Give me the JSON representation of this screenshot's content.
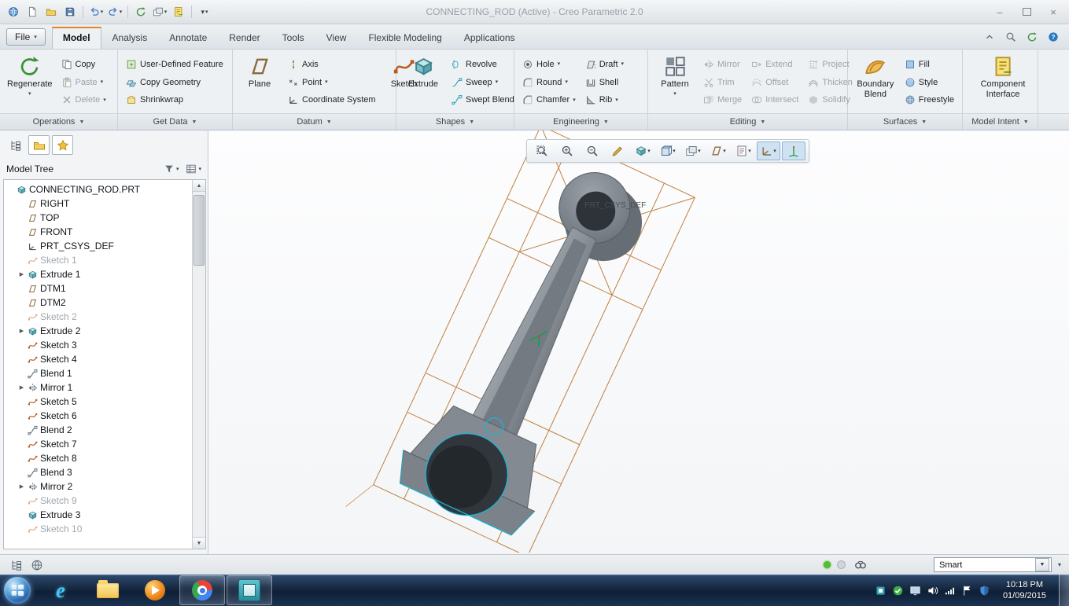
{
  "window": {
    "title": "CONNECTING_ROD (Active) - Creo Parametric 2.0"
  },
  "quick_access": {
    "items": [
      {
        "n": "app"
      },
      {
        "n": "new-document"
      },
      {
        "n": "open-file"
      },
      {
        "n": "save"
      },
      {
        "sep": true
      },
      {
        "n": "undo",
        "drop": true
      },
      {
        "n": "redo",
        "drop": true
      },
      {
        "sep": true
      },
      {
        "n": "regenerate-quick"
      },
      {
        "n": "window-arrange",
        "drop": true
      },
      {
        "n": "window-new"
      },
      {
        "sep": true
      },
      {
        "n": "customize-menu",
        "drop": true
      }
    ]
  },
  "ribbon": {
    "file": "File",
    "tabs": [
      "Model",
      "Analysis",
      "Annotate",
      "Render",
      "Tools",
      "View",
      "Flexible Modeling",
      "Applications"
    ],
    "active_tab": "Model",
    "groups": [
      "Operations",
      "Get Data",
      "Datum",
      "Shapes",
      "Engineering",
      "Editing",
      "Surfaces",
      "Model Intent"
    ],
    "buttons": {
      "regenerate": "Regenerate",
      "copy": "Copy",
      "paste": "Paste",
      "delete": "Delete",
      "udf": "User-Defined Feature",
      "copy_geometry": "Copy Geometry",
      "shrinkwrap": "Shrinkwrap",
      "plane": "Plane",
      "axis": "Axis",
      "point": "Point",
      "coordinate_system": "Coordinate System",
      "sketch": "Sketch",
      "extrude": "Extrude",
      "revolve": "Revolve",
      "sweep": "Sweep",
      "swept_blend": "Swept Blend",
      "hole": "Hole",
      "round": "Round",
      "chamfer": "Chamfer",
      "draft": "Draft",
      "shell": "Shell",
      "rib": "Rib",
      "pattern": "Pattern",
      "mirror": "Mirror",
      "trim": "Trim",
      "merge": "Merge",
      "extend": "Extend",
      "offset": "Offset",
      "intersect": "Intersect",
      "project": "Project",
      "thicken": "Thicken",
      "solidify": "Solidify",
      "boundary_blend": "Boundary Blend",
      "fill": "Fill",
      "style": "Style",
      "freestyle": "Freestyle",
      "component_interface": "Component Interface"
    },
    "right_icons": [
      {
        "n": "collapse-ribbon"
      },
      {
        "n": "search-commands"
      },
      {
        "n": "sync"
      },
      {
        "n": "help"
      }
    ]
  },
  "panel": {
    "toolbar": [
      {
        "n": "nav-tree"
      },
      {
        "n": "folder-browser",
        "pressed": true
      },
      {
        "n": "favorites",
        "pressed": true
      }
    ],
    "header": {
      "title": "Model Tree",
      "icons": [
        {
          "n": "tree-filters",
          "drop": true
        },
        {
          "n": "tree-columns",
          "drop": true
        }
      ]
    },
    "tree": {
      "items": [
        {
          "label": "CONNECTING_ROD.PRT",
          "type": "part",
          "level": 0
        },
        {
          "label": "RIGHT",
          "type": "plane",
          "level": 1
        },
        {
          "label": "TOP",
          "type": "plane",
          "level": 1
        },
        {
          "label": "FRONT",
          "type": "plane",
          "level": 1
        },
        {
          "label": "PRT_CSYS_DEF",
          "type": "csys",
          "level": 1
        },
        {
          "label": "Sketch 1",
          "type": "sketch",
          "level": 1,
          "dim": true
        },
        {
          "label": "Extrude 1",
          "type": "extrude",
          "level": 1,
          "expand": true
        },
        {
          "label": "DTM1",
          "type": "plane",
          "level": 1
        },
        {
          "label": "DTM2",
          "type": "plane",
          "level": 1
        },
        {
          "label": "Sketch 2",
          "type": "sketch",
          "level": 1,
          "dim": true
        },
        {
          "label": "Extrude 2",
          "type": "extrude",
          "level": 1,
          "expand": true
        },
        {
          "label": "Sketch 3",
          "type": "sketch",
          "level": 1
        },
        {
          "label": "Sketch 4",
          "type": "sketch",
          "level": 1
        },
        {
          "label": "Blend 1",
          "type": "blend",
          "level": 1
        },
        {
          "label": "Mirror 1",
          "type": "mirror",
          "level": 1,
          "expand": true
        },
        {
          "label": "Sketch 5",
          "type": "sketch",
          "level": 1
        },
        {
          "label": "Sketch 6",
          "type": "sketch",
          "level": 1
        },
        {
          "label": "Blend 2",
          "type": "blend",
          "level": 1
        },
        {
          "label": "Sketch 7",
          "type": "sketch",
          "level": 1
        },
        {
          "label": "Sketch 8",
          "type": "sketch",
          "level": 1
        },
        {
          "label": "Blend 3",
          "type": "blend",
          "level": 1
        },
        {
          "label": "Mirror 2",
          "type": "mirror",
          "level": 1,
          "expand": true
        },
        {
          "label": "Sketch 9",
          "type": "sketch",
          "level": 1,
          "dim": true
        },
        {
          "label": "Extrude 3",
          "type": "extrude",
          "level": 1
        },
        {
          "label": "Sketch 10",
          "type": "sketch",
          "level": 1,
          "dim": true
        }
      ]
    }
  },
  "canvas": {
    "toolbar": [
      {
        "n": "refit"
      },
      {
        "n": "zoom-in"
      },
      {
        "n": "zoom-out"
      },
      {
        "n": "repaint"
      },
      {
        "n": "display-style",
        "drop": true
      },
      {
        "n": "saved-orientations",
        "drop": true
      },
      {
        "n": "view-manager",
        "drop": true
      },
      {
        "n": "datum-display",
        "drop": true
      },
      {
        "n": "annotation-display",
        "drop": true
      },
      {
        "n": "datum-filters",
        "drop": true,
        "pressed": true
      },
      {
        "n": "spin-center",
        "pressed": true
      }
    ],
    "csys_label": "PRT_CSYS_DEF"
  },
  "status": {
    "left_icons": [
      {
        "n": "navigator-toggle"
      },
      {
        "n": "web-browser-toggle"
      }
    ],
    "filter_label": "Smart"
  },
  "taskbar": {
    "apps": [
      {
        "n": "internet-explorer"
      },
      {
        "n": "windows-explorer"
      },
      {
        "n": "media-player"
      },
      {
        "n": "chrome",
        "open": true
      },
      {
        "n": "creo",
        "open": true
      }
    ],
    "tray": [
      {
        "n": "tray-app"
      },
      {
        "n": "updates-ready"
      },
      {
        "n": "display-settings"
      },
      {
        "n": "volume"
      },
      {
        "n": "network"
      },
      {
        "n": "action-center-flag"
      },
      {
        "n": "security-shield"
      }
    ],
    "time": "10:18 PM",
    "date": "01/09/2015"
  },
  "colors": {
    "datum_curve": "#bd7a35",
    "highlight": "#15b8d8",
    "accent_tab": "#e0862a",
    "model_light": "#9aa0a7",
    "model_dark": "#70767d"
  }
}
